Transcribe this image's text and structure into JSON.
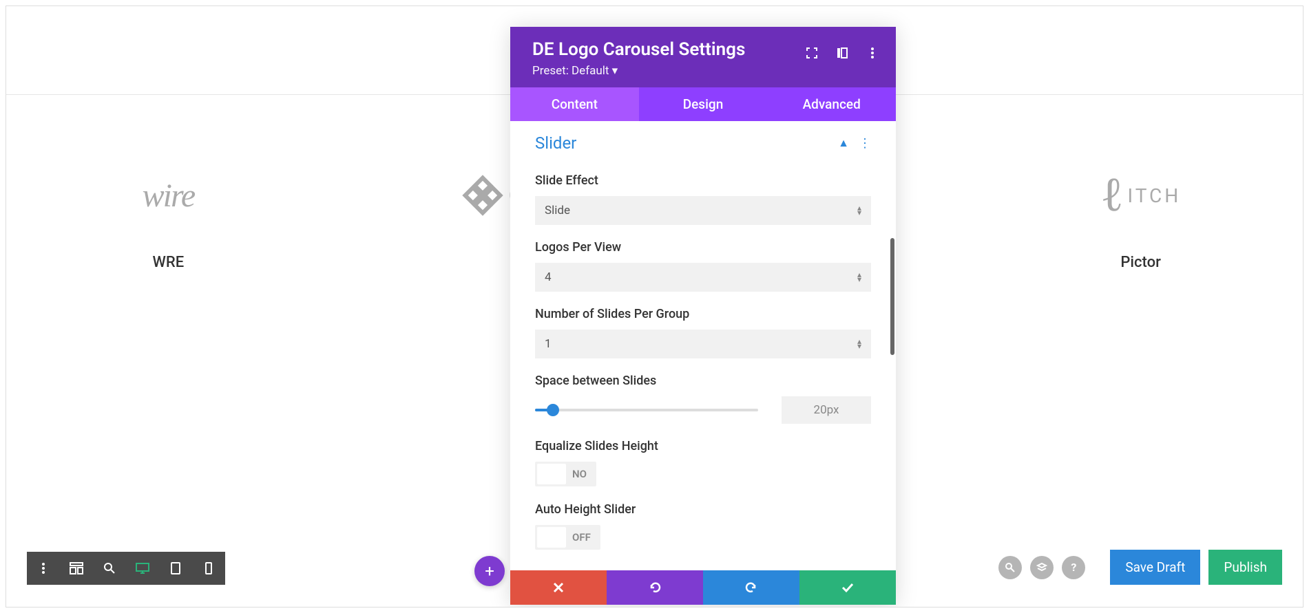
{
  "modal": {
    "title": "DE Logo Carousel Settings",
    "preset": "Preset: Default ▾",
    "tabs": {
      "content": "Content",
      "design": "Design",
      "advanced": "Advanced"
    },
    "section": {
      "title": "Slider",
      "fields": {
        "slide_effect": {
          "label": "Slide Effect",
          "value": "Slide"
        },
        "logos_per_view": {
          "label": "Logos Per View",
          "value": "4"
        },
        "slides_per_group": {
          "label": "Number of Slides Per Group",
          "value": "1"
        },
        "space_between": {
          "label": "Space between Slides",
          "value": "20px"
        },
        "equalize_height": {
          "label": "Equalize Slides Height",
          "value": "NO"
        },
        "auto_height": {
          "label": "Auto Height Slider",
          "value": "OFF"
        }
      }
    }
  },
  "logos": {
    "items": [
      {
        "name": "WRE"
      },
      {
        "name": ""
      },
      {
        "name": ""
      },
      {
        "name": "Pictor"
      }
    ]
  },
  "actions": {
    "save_draft": "Save Draft",
    "publish": "Publish",
    "add": "+"
  },
  "pitch_text": "ITCH"
}
